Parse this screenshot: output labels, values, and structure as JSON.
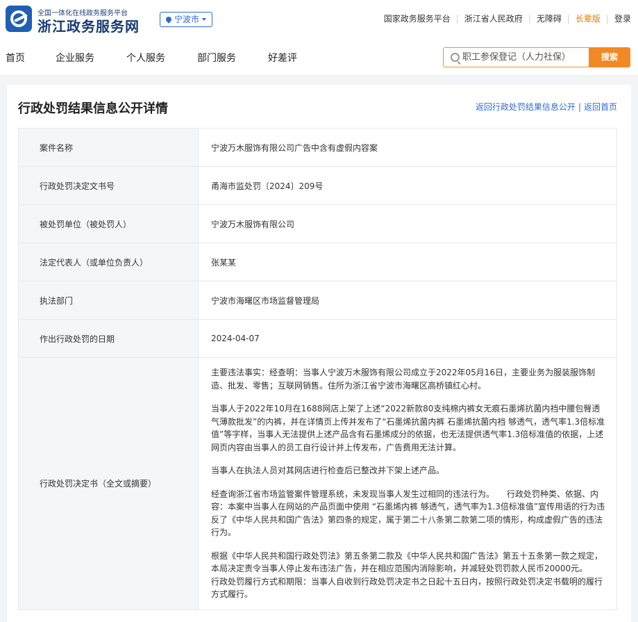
{
  "header": {
    "logo_subtitle": "全国一体化在线政务服务平台",
    "logo_title": "浙江政务服务网",
    "city": "宁波市",
    "links": [
      "国家政务服务平台",
      "浙江省人民政府",
      "无障碍",
      "长辈版",
      "登录"
    ]
  },
  "nav": {
    "items": [
      "首页",
      "企业服务",
      "个人服务",
      "部门服务",
      "好差评"
    ],
    "search_placeholder": "职工参保登记（人力社保）",
    "search_button": "搜索"
  },
  "page": {
    "title": "行政处罚结果信息公开详情",
    "back_link": "返回行政处罚结果信息公开",
    "home_link": "返回首页"
  },
  "detail": {
    "rows": [
      {
        "label": "案件名称",
        "value": "宁波万木服饰有限公司广告中含有虚假内容案"
      },
      {
        "label": "行政处罚决定文书号",
        "value": "甬海市监处罚〔2024〕209号"
      },
      {
        "label": "被处罚单位（被处罚人）",
        "value": "宁波万木服饰有限公司"
      },
      {
        "label": "法定代表人（或单位负责人）",
        "value": "张某某"
      },
      {
        "label": "执法部门",
        "value": "宁波市海曙区市场监督管理局"
      },
      {
        "label": "作出行政处罚的日期",
        "value": "2024-04-07"
      }
    ],
    "decision_label": "行政处罚决定书（全文或摘要）",
    "decision_paragraphs": [
      "主要违法事实：经查明：当事人宁波万木服饰有限公司成立于2022年05月16日，主要业务为服装服饰制造、批发、零售；互联网销售。住所为浙江省宁波市海曙区高桥镇红心村。",
      "当事人于2022年10月在1688网店上架了上述“2022新款80支纯棉内裤女无痕石墨烯抗菌内裆中腰包臀透气薄款批发”的内裤，并在详情页上传并发布了“石墨烯抗菌内裤 石墨烯抗菌内裆 够透气，透气率1.3倍标准值”等字样，当事人无法提供上述产品含有石墨烯成分的依据，也无法提供透气率1.3倍标准值的依据，上述网页内容由当事人的员工自行设计并上传发布，广告费用无法计算。",
      "当事人在执法人员对其网店进行检查后已整改并下架上述产品。",
      "经查询浙江省市场监管案件管理系统，未发现当事人发生过相同的违法行为。　　行政处罚种类、依据、内容：本案中当事人在网站的产品页面中使用 “石墨烯内裤 够透气，透气率为1.3倍标准值”宣传用语的行为违反了《中华人民共和国广告法》第四条的规定，属于第二十八条第二款第二项的情形，构成虚假广告的违法行为。",
      "根据《中华人民共和国行政处罚法》第五条第二款及《中华人民共和国广告法》第五十五条第一款之规定，本局决定责令当事人停止发布违法广告，并在相应范围内消除影响，并减轻处罚罚款人民币20000元。　　行政处罚履行方式和期限：当事人自收到行政处罚决定书之日起十五日内，按照行政处罚决定书载明的履行方式履行。"
    ]
  }
}
